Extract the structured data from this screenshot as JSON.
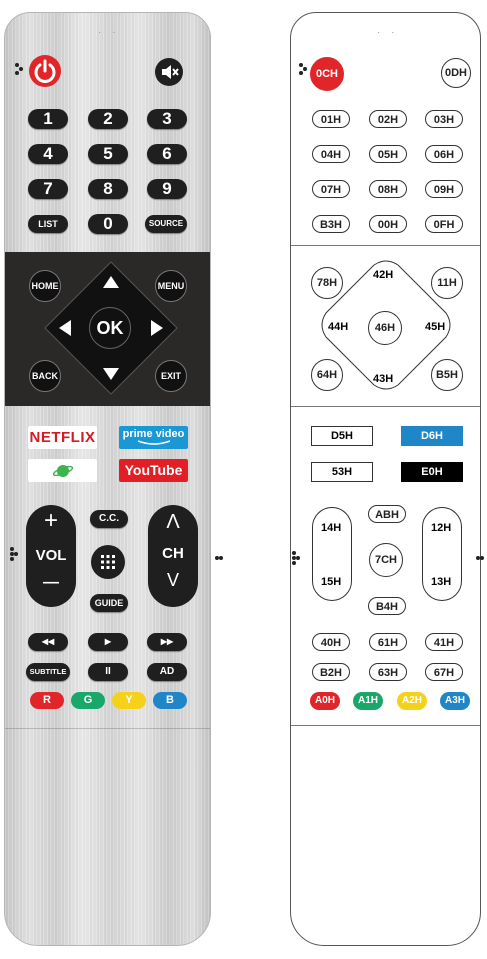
{
  "left_remote": {
    "numbers": [
      "1",
      "2",
      "3",
      "4",
      "5",
      "6",
      "7",
      "8",
      "9"
    ],
    "list": "LIST",
    "zero": "0",
    "source": "SOURCE",
    "home": "HOME",
    "menu": "MENU",
    "ok": "OK",
    "back": "BACK",
    "exit": "EXIT",
    "netflix": "NETFLIX",
    "prime": "prime video",
    "youtube": "YouTube",
    "vol_plus": "+",
    "vol": "VOL",
    "vol_minus": "—",
    "cc": "C.C.",
    "guide": "GUIDE",
    "ch": "CH",
    "ch_up": "Λ",
    "ch_down": "V",
    "rewind": "◀◀",
    "play": "▶",
    "ff": "▶▶",
    "subtitle": "SUBTITLE",
    "pause": "II",
    "ad": "AD",
    "r": "R",
    "g": "G",
    "y": "Y",
    "b": "B",
    "colors": {
      "red": "#e1262a",
      "green": "#1aa86a",
      "yellow": "#f6d11a",
      "blue": "#1f86c8",
      "power": "#e1262a",
      "netflix": "#d71920",
      "youtube": "#e21f25",
      "prime": "#1a98d5"
    }
  },
  "right_remote": {
    "power": "0CH",
    "mute": "0DH",
    "r1": [
      "01H",
      "02H",
      "03H"
    ],
    "r2": [
      "04H",
      "05H",
      "06H"
    ],
    "r3": [
      "07H",
      "08H",
      "09H"
    ],
    "r4": [
      "B3H",
      "00H",
      "0FH"
    ],
    "home": "78H",
    "up": "42H",
    "menu": "11H",
    "left": "44H",
    "ok": "46H",
    "right": "45H",
    "back": "64H",
    "down": "43H",
    "exit": "B5H",
    "netflix": "D5H",
    "prime": "D6H",
    "app": "53H",
    "youtube": "E0H",
    "vol_up": "14H",
    "vol_down": "15H",
    "cc": "ABH",
    "menu_grid": "7CH",
    "guide": "B4H",
    "ch_up": "12H",
    "ch_down": "13H",
    "m1": [
      "40H",
      "61H",
      "41H"
    ],
    "m2": [
      "B2H",
      "63H",
      "67H"
    ],
    "c": [
      "A0H",
      "A1H",
      "A2H",
      "A3H"
    ]
  }
}
